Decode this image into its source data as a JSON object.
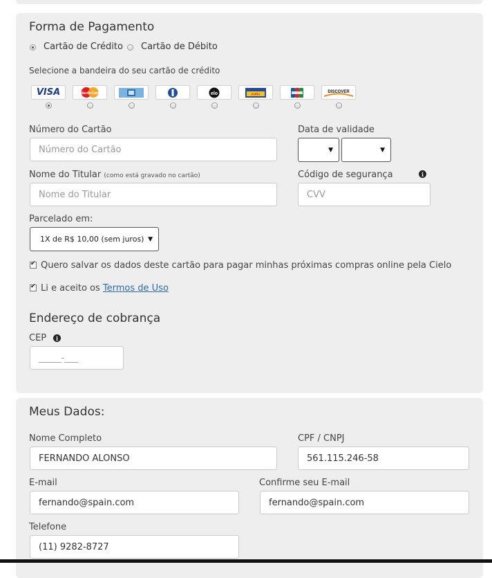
{
  "payment": {
    "title": "Forma de Pagamento",
    "method_options": [
      {
        "label": "Cartão de Crédito",
        "selected": true
      },
      {
        "label": "Cartão de Débito",
        "selected": false
      }
    ],
    "brand_prompt": "Selecione a bandeira do seu cartão de crédito",
    "brands": [
      {
        "name": "visa-logo",
        "text": "VISA",
        "selected": true
      },
      {
        "name": "mastercard-logo",
        "text": "MasterCard",
        "selected": false
      },
      {
        "name": "amex-logo",
        "text": "",
        "selected": false
      },
      {
        "name": "diners-logo",
        "text": "",
        "selected": false
      },
      {
        "name": "elo-logo",
        "text": "elo",
        "selected": false
      },
      {
        "name": "aura-logo",
        "text": "AURA",
        "selected": false
      },
      {
        "name": "jcb-logo",
        "text": "JCB",
        "selected": false
      },
      {
        "name": "discover-logo",
        "text": "DISCOVER",
        "selected": false
      }
    ],
    "card_number": {
      "label": "Número do Cartão",
      "placeholder": "Número do Cartão",
      "value": ""
    },
    "expiry": {
      "label": "Data de validade",
      "month": "",
      "year": ""
    },
    "holder": {
      "label": "Nome do Titular",
      "hint": "(como está gravado no cartão)",
      "placeholder": "Nome do Titular",
      "value": ""
    },
    "security_code": {
      "label": "Código de segurança",
      "placeholder": "CVV",
      "value": "",
      "icon": "info-icon"
    },
    "installments": {
      "label": "Parcelado em:",
      "selected": "1X de R$ 10,00 (sem juros)"
    },
    "save_card": {
      "label": "Quero salvar os dados deste cartão para pagar minhas próximas compras online pela Cielo",
      "checked": true
    },
    "terms": {
      "label_prefix": "Li e aceito os",
      "link": "Termos de Uso",
      "checked": true
    }
  },
  "billing": {
    "title": "Endereço de cobrança",
    "cep": {
      "label": "CEP",
      "placeholder": "_____-___",
      "value": "",
      "icon": "info-icon"
    }
  },
  "dados": {
    "title": "Meus Dados:",
    "full_name": {
      "label": "Nome Completo",
      "value": "FERNANDO ALONSO"
    },
    "cpf": {
      "label": "CPF / CNPJ",
      "value": "561.115.246-58"
    },
    "email": {
      "label": "E-mail",
      "value": "fernando@spain.com"
    },
    "email_confirm": {
      "label": "Confirme seu E-mail",
      "value": "fernando@spain.com"
    },
    "phone": {
      "label": "Telefone",
      "value": "(11) 9282-8727"
    }
  },
  "colors": {
    "panel_bg": "#eeeeee",
    "link": "#2a6cb3"
  }
}
